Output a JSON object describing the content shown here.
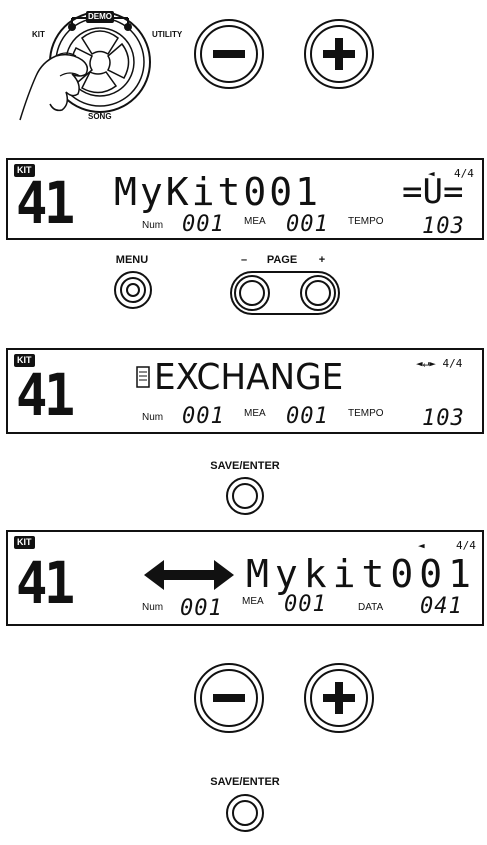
{
  "dial": {
    "labels": {
      "demo": "DEMO",
      "kit": "KIT",
      "utility": "UTILITY",
      "song": "SONG"
    }
  },
  "stepper": {
    "minus": "−",
    "plus": "+"
  },
  "lcd1": {
    "kit_tag": "KIT",
    "number": "41",
    "text": "MyKit001",
    "right": "=U=",
    "arrow": "◄",
    "meter": "4/4",
    "num_label": "Num",
    "num_value": "001",
    "mea_label": "MEA",
    "mea_value": "001",
    "tempo_label": "TEMPO",
    "tempo_value": "103"
  },
  "menu_page": {
    "menu_label": "MENU",
    "page_label": "PAGE",
    "minus": "–",
    "plus": "+"
  },
  "lcd2": {
    "kit_tag": "KIT",
    "number": "41",
    "text": "EXCHANGE",
    "arrows": "◄↵► 4/4",
    "num_label": "Num",
    "num_value": "001",
    "mea_label": "MEA",
    "mea_value": "001",
    "tempo_label": "TEMPO",
    "tempo_value": "103"
  },
  "save1": {
    "label": "SAVE/ENTER"
  },
  "lcd3": {
    "kit_tag": "KIT",
    "number": "41",
    "text": "Mykit001",
    "arrow": "◄",
    "meter": "4/4",
    "num_label": "Num",
    "num_value": "001",
    "mea_label": "MEA",
    "mea_value": "001",
    "data_label": "DATA",
    "data_value": "041"
  },
  "stepper2": {
    "minus": "−",
    "plus": "+"
  },
  "save2": {
    "label": "SAVE/ENTER"
  }
}
